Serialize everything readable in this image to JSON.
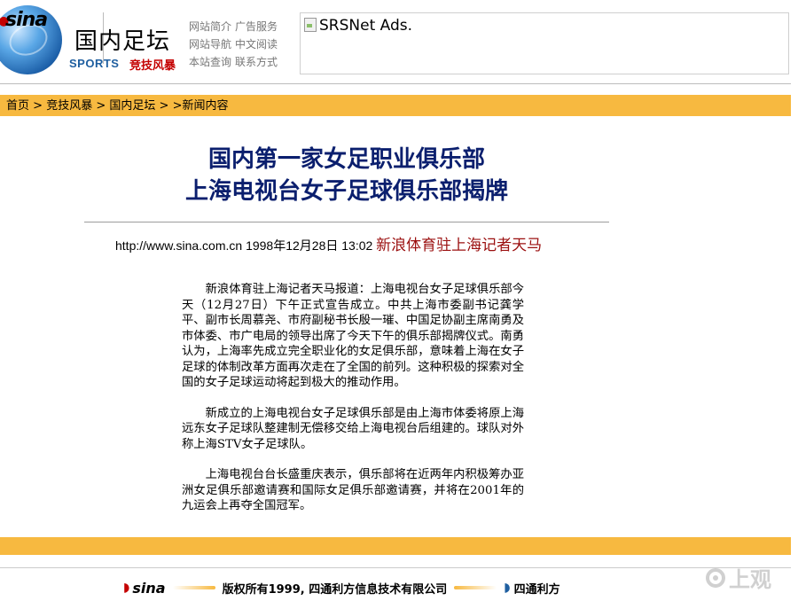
{
  "header": {
    "logo_text": "sina",
    "section_title": "国内足坛",
    "sports_label": "SPORTS",
    "sports_sub": "竞技风暴",
    "quick_links": [
      [
        "网站简介",
        "广告服务"
      ],
      [
        "网站导航",
        "中文阅读"
      ],
      [
        "本站查询",
        "联系方式"
      ]
    ],
    "ad_alt": "SRSNet Ads."
  },
  "breadcrumb": {
    "items": [
      "首页",
      "竞技风暴",
      "国内足坛",
      ">新闻内容"
    ],
    "separator": " > "
  },
  "article": {
    "headline_line1": "国内第一家女足职业俱乐部",
    "headline_line2": "上海电视台女子足球俱乐部揭牌",
    "source_url": "http://www.sina.com.cn",
    "date": "1998年12月28日 13:02",
    "reporter": "新浪体育驻上海记者天马",
    "paragraphs": [
      "新浪体育驻上海记者天马报道：上海电视台女子足球俱乐部今天（12月27日）下午正式宣告成立。中共上海市委副书记龚学平、副市长周慕尧、市府副秘书长殷一璀、中国足协副主席南勇及市体委、市广电局的领导出席了今天下午的俱乐部揭牌仪式。南勇认为，上海率先成立完全职业化的女足俱乐部，意味着上海在女子足球的体制改革方面再次走在了全国的前列。这种积极的探索对全国的女子足球运动将起到极大的推动作用。",
      "新成立的上海电视台女子足球俱乐部是由上海市体委将原上海远东女子足球队整建制无偿移交给上海电视台后组建的。球队对外称上海STV女子足球队。",
      "上海电视台台长盛重庆表示，俱乐部将在近两年内积极筹办亚洲女足俱乐部邀请赛和国际女足俱乐部邀请赛，并将在2001年的九运会上再夺全国冠军。"
    ]
  },
  "footer": {
    "logo_text": "sina",
    "copyright": "版权所有1999, 四通利方信息技术有限公司",
    "company_logo_text": "四通利方"
  },
  "watermark": {
    "text": "上观"
  },
  "colors": {
    "accent_bar": "#f7b940",
    "headline": "#0b1f6e",
    "reporter": "#9b1010",
    "sina_red": "#c40000",
    "sports_blue": "#1f5fa0"
  }
}
